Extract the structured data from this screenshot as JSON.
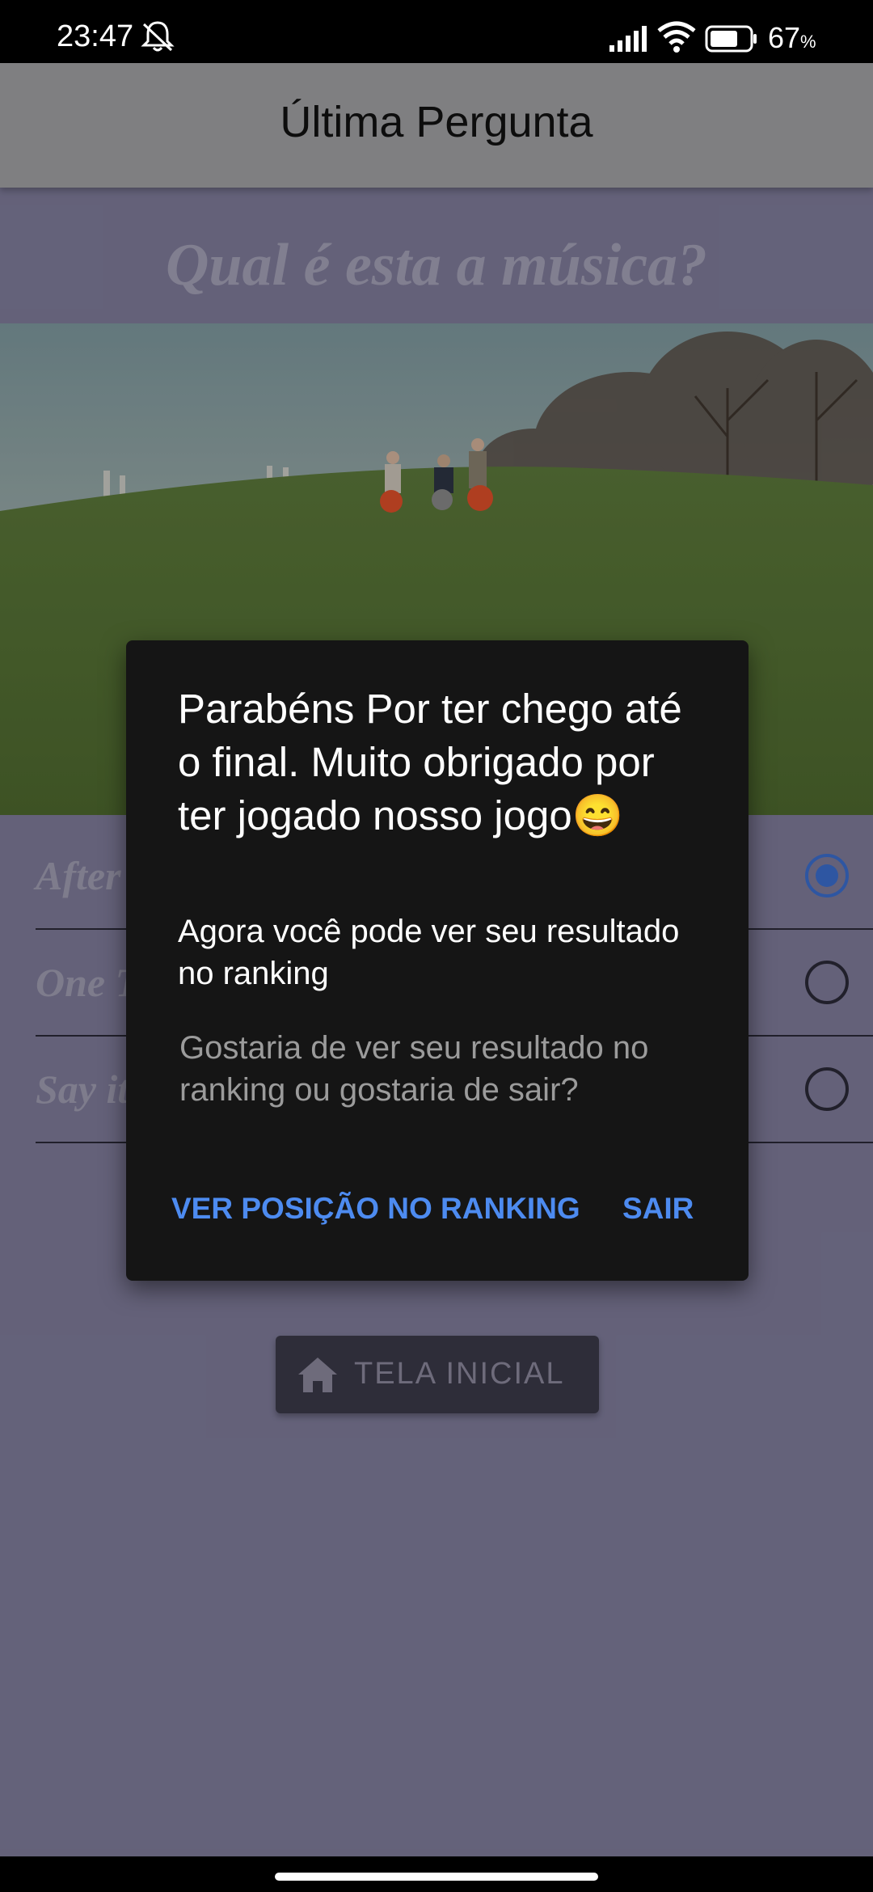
{
  "status": {
    "time": "23:47",
    "battery": "67",
    "battery_unit": "%"
  },
  "appbar": {
    "title": "Última Pergunta"
  },
  "question": "Qual é esta a música?",
  "options": [
    {
      "label": "After",
      "selected": true
    },
    {
      "label": "One T",
      "selected": false
    },
    {
      "label": "Say it",
      "selected": false
    }
  ],
  "home_button": {
    "label": "TELA INICIAL",
    "icon": "home-icon"
  },
  "dialog": {
    "title": "Parabéns Por ter chego até o final. Muito obrigado por ter jogado nosso jogo😄",
    "subtitle": "Agora você pode ver seu resultado no ranking",
    "message": "Gostaria de ver seu resultado no ranking ou gostaria de sair?",
    "positive": "VER POSIÇÃO NO RANKING",
    "negative": "SAIR"
  },
  "colors": {
    "accent": "#4d8bf0",
    "background": "#807d9c",
    "dialog": "#151515"
  }
}
